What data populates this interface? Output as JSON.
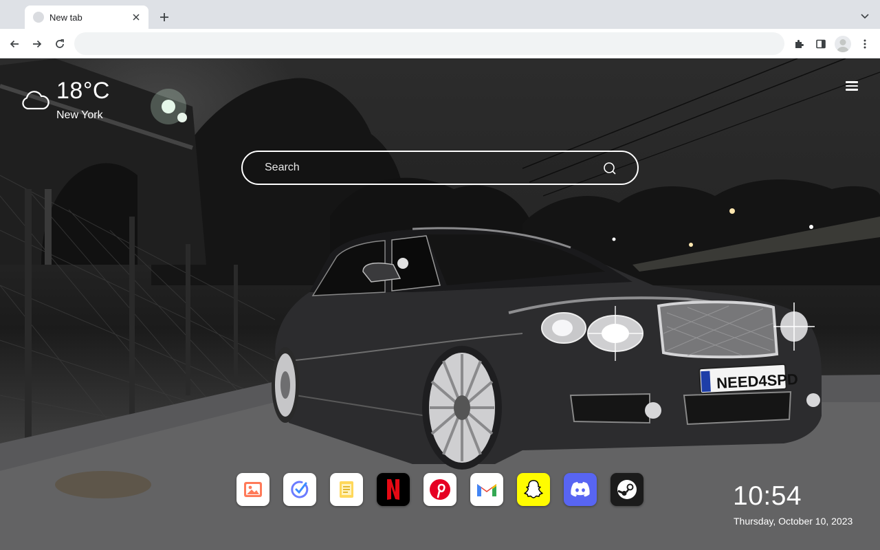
{
  "tab": {
    "title": "New tab"
  },
  "toolbar": {
    "omnibox_value": "",
    "omnibox_placeholder": ""
  },
  "weather": {
    "temperature": "18°C",
    "city": "New York",
    "icon": "cloud-icon"
  },
  "search": {
    "placeholder": "Search"
  },
  "apps": [
    {
      "name": "photos",
      "icon": "image-icon",
      "bg": "#ffffff"
    },
    {
      "name": "tasks",
      "icon": "check-circle-icon",
      "bg": "#ffffff"
    },
    {
      "name": "notes",
      "icon": "note-icon",
      "bg": "#ffffff"
    },
    {
      "name": "netflix",
      "icon": "netflix-icon",
      "bg": "#000000",
      "letter": "N"
    },
    {
      "name": "pinterest",
      "icon": "pinterest-icon",
      "bg": "#ffffff"
    },
    {
      "name": "gmail",
      "icon": "gmail-icon",
      "bg": "#ffffff"
    },
    {
      "name": "snapchat",
      "icon": "snapchat-icon",
      "bg": "#fffc00"
    },
    {
      "name": "discord",
      "icon": "discord-icon",
      "bg": "#5865f2"
    },
    {
      "name": "steam",
      "icon": "steam-icon",
      "bg": "#1b1b1b"
    }
  ],
  "clock": {
    "time": "10:54",
    "date": "Thursday, October 10, 2023"
  },
  "license_plate": "NEED4SPD",
  "colors": {
    "tabstrip": "#dee1e6",
    "netflix_red": "#e50914",
    "pinterest_red": "#e60023",
    "discord_blurple": "#5865f2",
    "snapchat_yellow": "#fffc00"
  }
}
